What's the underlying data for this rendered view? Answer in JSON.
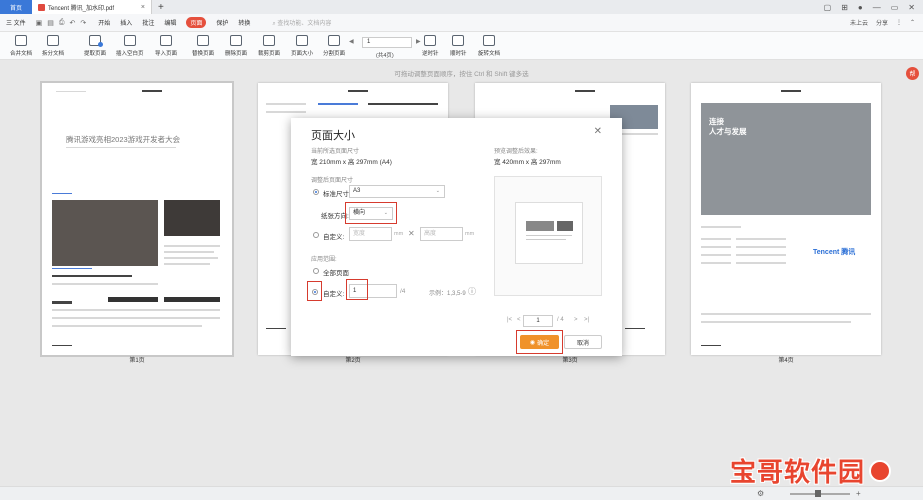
{
  "titlebar": {
    "home_tab": "首页",
    "doc_tab": "Tencent 腾讯_加水印.pdf",
    "close": "×",
    "add_tab": "+"
  },
  "menubar": {
    "file": "三 文件",
    "items": [
      "开始",
      "插入",
      "批注",
      "编辑",
      "页面",
      "保护",
      "转换"
    ],
    "active_index": 4,
    "search_placeholder": "查找功能、文档内容",
    "upload": "未上云",
    "share": "分享"
  },
  "toolbar": {
    "tools": [
      "合并文档",
      "拆分文档",
      "提取页面",
      "插入空白页",
      "导入页面",
      "替换页面",
      "删除页面",
      "裁剪页面",
      "页面大小",
      "分割页面",
      "逆时针",
      "顺时针",
      "旋转文档"
    ],
    "page_value": "1",
    "page_total": "(共4页)"
  },
  "hint": "可拖动调整页面顺序，按住 Ctrl 和 Shift 键多选",
  "help_badge": "帮",
  "pages": [
    {
      "label": "第1页",
      "title": "腾讯游戏亮相2023游戏开发者大会"
    },
    {
      "label": "第2页"
    },
    {
      "label": "第3页"
    },
    {
      "label": "第4页",
      "headline": "连接\n人才与发展",
      "brand": "Tencent 腾讯"
    }
  ],
  "dialog": {
    "title": "页面大小",
    "current_size_label": "当前所选页面尺寸",
    "current_size": "宽 210mm x 高 297mm (A4)",
    "adjust_label": "调整后页面尺寸",
    "standard_label": "标准尺寸:",
    "standard_value": "A3",
    "orientation_label": "纸张方向:",
    "orientation_value": "横向",
    "custom_label": "自定义:",
    "width_placeholder": "宽度",
    "height_placeholder": "高度",
    "unit": "mm",
    "range_label": "应用范围:",
    "all_pages": "全部页面",
    "custom_range_label": "自定义:",
    "custom_range_value": "1",
    "range_total": "/4",
    "range_example": "示例：1,3,5-9",
    "preview_label": "预览调整后效果:",
    "preview_size": "宽 420mm x 高 297mm",
    "pager_value": "1",
    "pager_total": "/ 4",
    "ok": "确定",
    "cancel": "取消"
  },
  "watermark": "宝哥软件园"
}
